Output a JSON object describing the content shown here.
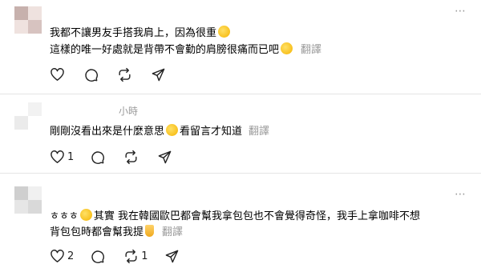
{
  "more_icon": "⋯",
  "icons": {
    "like": "heart-icon",
    "reply": "comment-icon",
    "repost": "repost-icon",
    "share": "send-icon"
  },
  "posts": [
    {
      "avatar_colors": [
        "#c7b1ad",
        "#efe2df",
        "#efe2df",
        "#d7c3c0"
      ],
      "time": "",
      "lines": [
        "我都不讓男友手搭我肩上，因為很重",
        "這樣的唯一好處就是背帶不會勤的肩膀很痛而已吧"
      ],
      "translate": "翻譯",
      "counts": {
        "like": "",
        "reply": "",
        "repost": ""
      }
    },
    {
      "avatar_colors": [
        "#ffffff",
        "#f2f2f2",
        "#ebebeb",
        "#ffffff"
      ],
      "time": "小時",
      "lines": [
        "剛剛沒看出來是什麼意思",
        "看留言才知道"
      ],
      "translate": "翻譯",
      "counts": {
        "like": "1",
        "reply": "",
        "repost": ""
      }
    },
    {
      "avatar_colors": [
        "#cfcfcf",
        "#f0f0f0",
        "#e6e6e6",
        "#d9d9d9"
      ],
      "time": "",
      "lines": [
        "ㅎㅎㅎ",
        "其實 我在韓國歐巴都會幫我拿包包也不會覺得奇怪，我手上拿咖啡不想",
        "背包包時都會幫我提"
      ],
      "translate": "翻譯",
      "counts": {
        "like": "2",
        "reply": "",
        "repost": "1"
      }
    }
  ]
}
